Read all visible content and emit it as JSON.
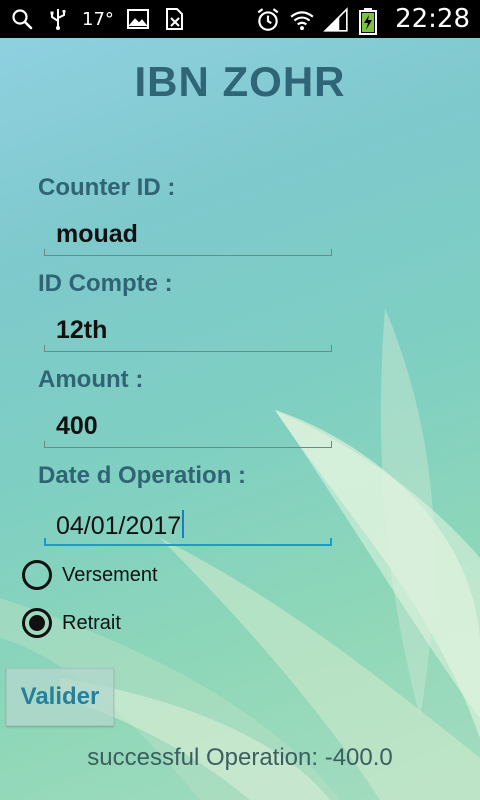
{
  "status_bar": {
    "temperature": "17°",
    "time": "22:28",
    "icons": [
      "search-icon",
      "usb-icon",
      "image-icon",
      "sim-icon",
      "alarm-icon",
      "wifi-icon",
      "signal-icon",
      "battery-charging-icon"
    ]
  },
  "app": {
    "title": "IBN ZOHR",
    "fields": [
      {
        "label": "Counter ID :",
        "value": "mouad"
      },
      {
        "label": "ID Compte :",
        "value": "12th"
      },
      {
        "label": "Amount :",
        "value": "400"
      },
      {
        "label": "Date d Operation :",
        "value": "04/01/2017"
      }
    ],
    "radios": [
      {
        "label": "Versement",
        "checked": false
      },
      {
        "label": "Retrait",
        "checked": true
      }
    ],
    "submit_label": "Valider",
    "result_text": "successful Operation: -400.0"
  },
  "colors": {
    "title": "#2f6576",
    "label": "#306475",
    "focus_underline": "#1a9bd0",
    "button_text": "#26809a"
  }
}
